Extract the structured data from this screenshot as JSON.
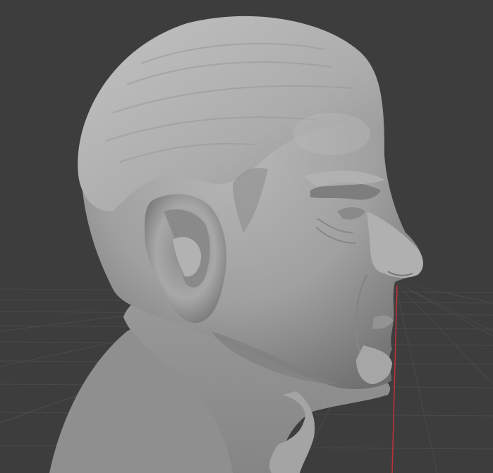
{
  "viewport": {
    "background": "#3d3d3d",
    "grid_color": "#4a4a4a",
    "x_axis_color": "#c0313c",
    "y_axis_color": "#c0313c"
  },
  "model": {
    "name": "bust-sculpt",
    "material_color": "#9c9c9c",
    "shading": "solid"
  }
}
